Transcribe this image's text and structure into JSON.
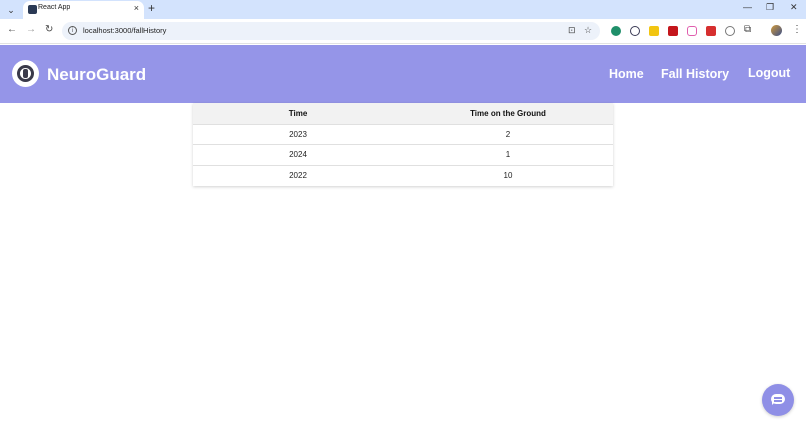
{
  "browser": {
    "tab_title": "React App",
    "url": "localhost:3000/fallHistory",
    "tab_close": "×",
    "new_tab": "+",
    "win_minimize": "—",
    "win_restore": "❐",
    "win_close": "✕",
    "back": "←",
    "forward": "→",
    "reload": "↻",
    "info": "i",
    "install": "⊡",
    "bookmark": "☆",
    "menu": "⋮",
    "tab_menu": "⌄",
    "extensions_icon": "⧉"
  },
  "header": {
    "brand": "NeuroGuard",
    "nav": [
      {
        "label": "Home"
      },
      {
        "label": "Fall History"
      },
      {
        "label": "Logout"
      }
    ],
    "background_color": "#9595e8"
  },
  "table": {
    "columns": [
      "Time",
      "Time on the Ground"
    ],
    "rows": [
      [
        "2023",
        "2"
      ],
      [
        "2024",
        "1"
      ],
      [
        "2022",
        "10"
      ]
    ]
  },
  "chat": {
    "icon": "chat-bubble-icon",
    "color": "#8f8fe6"
  }
}
